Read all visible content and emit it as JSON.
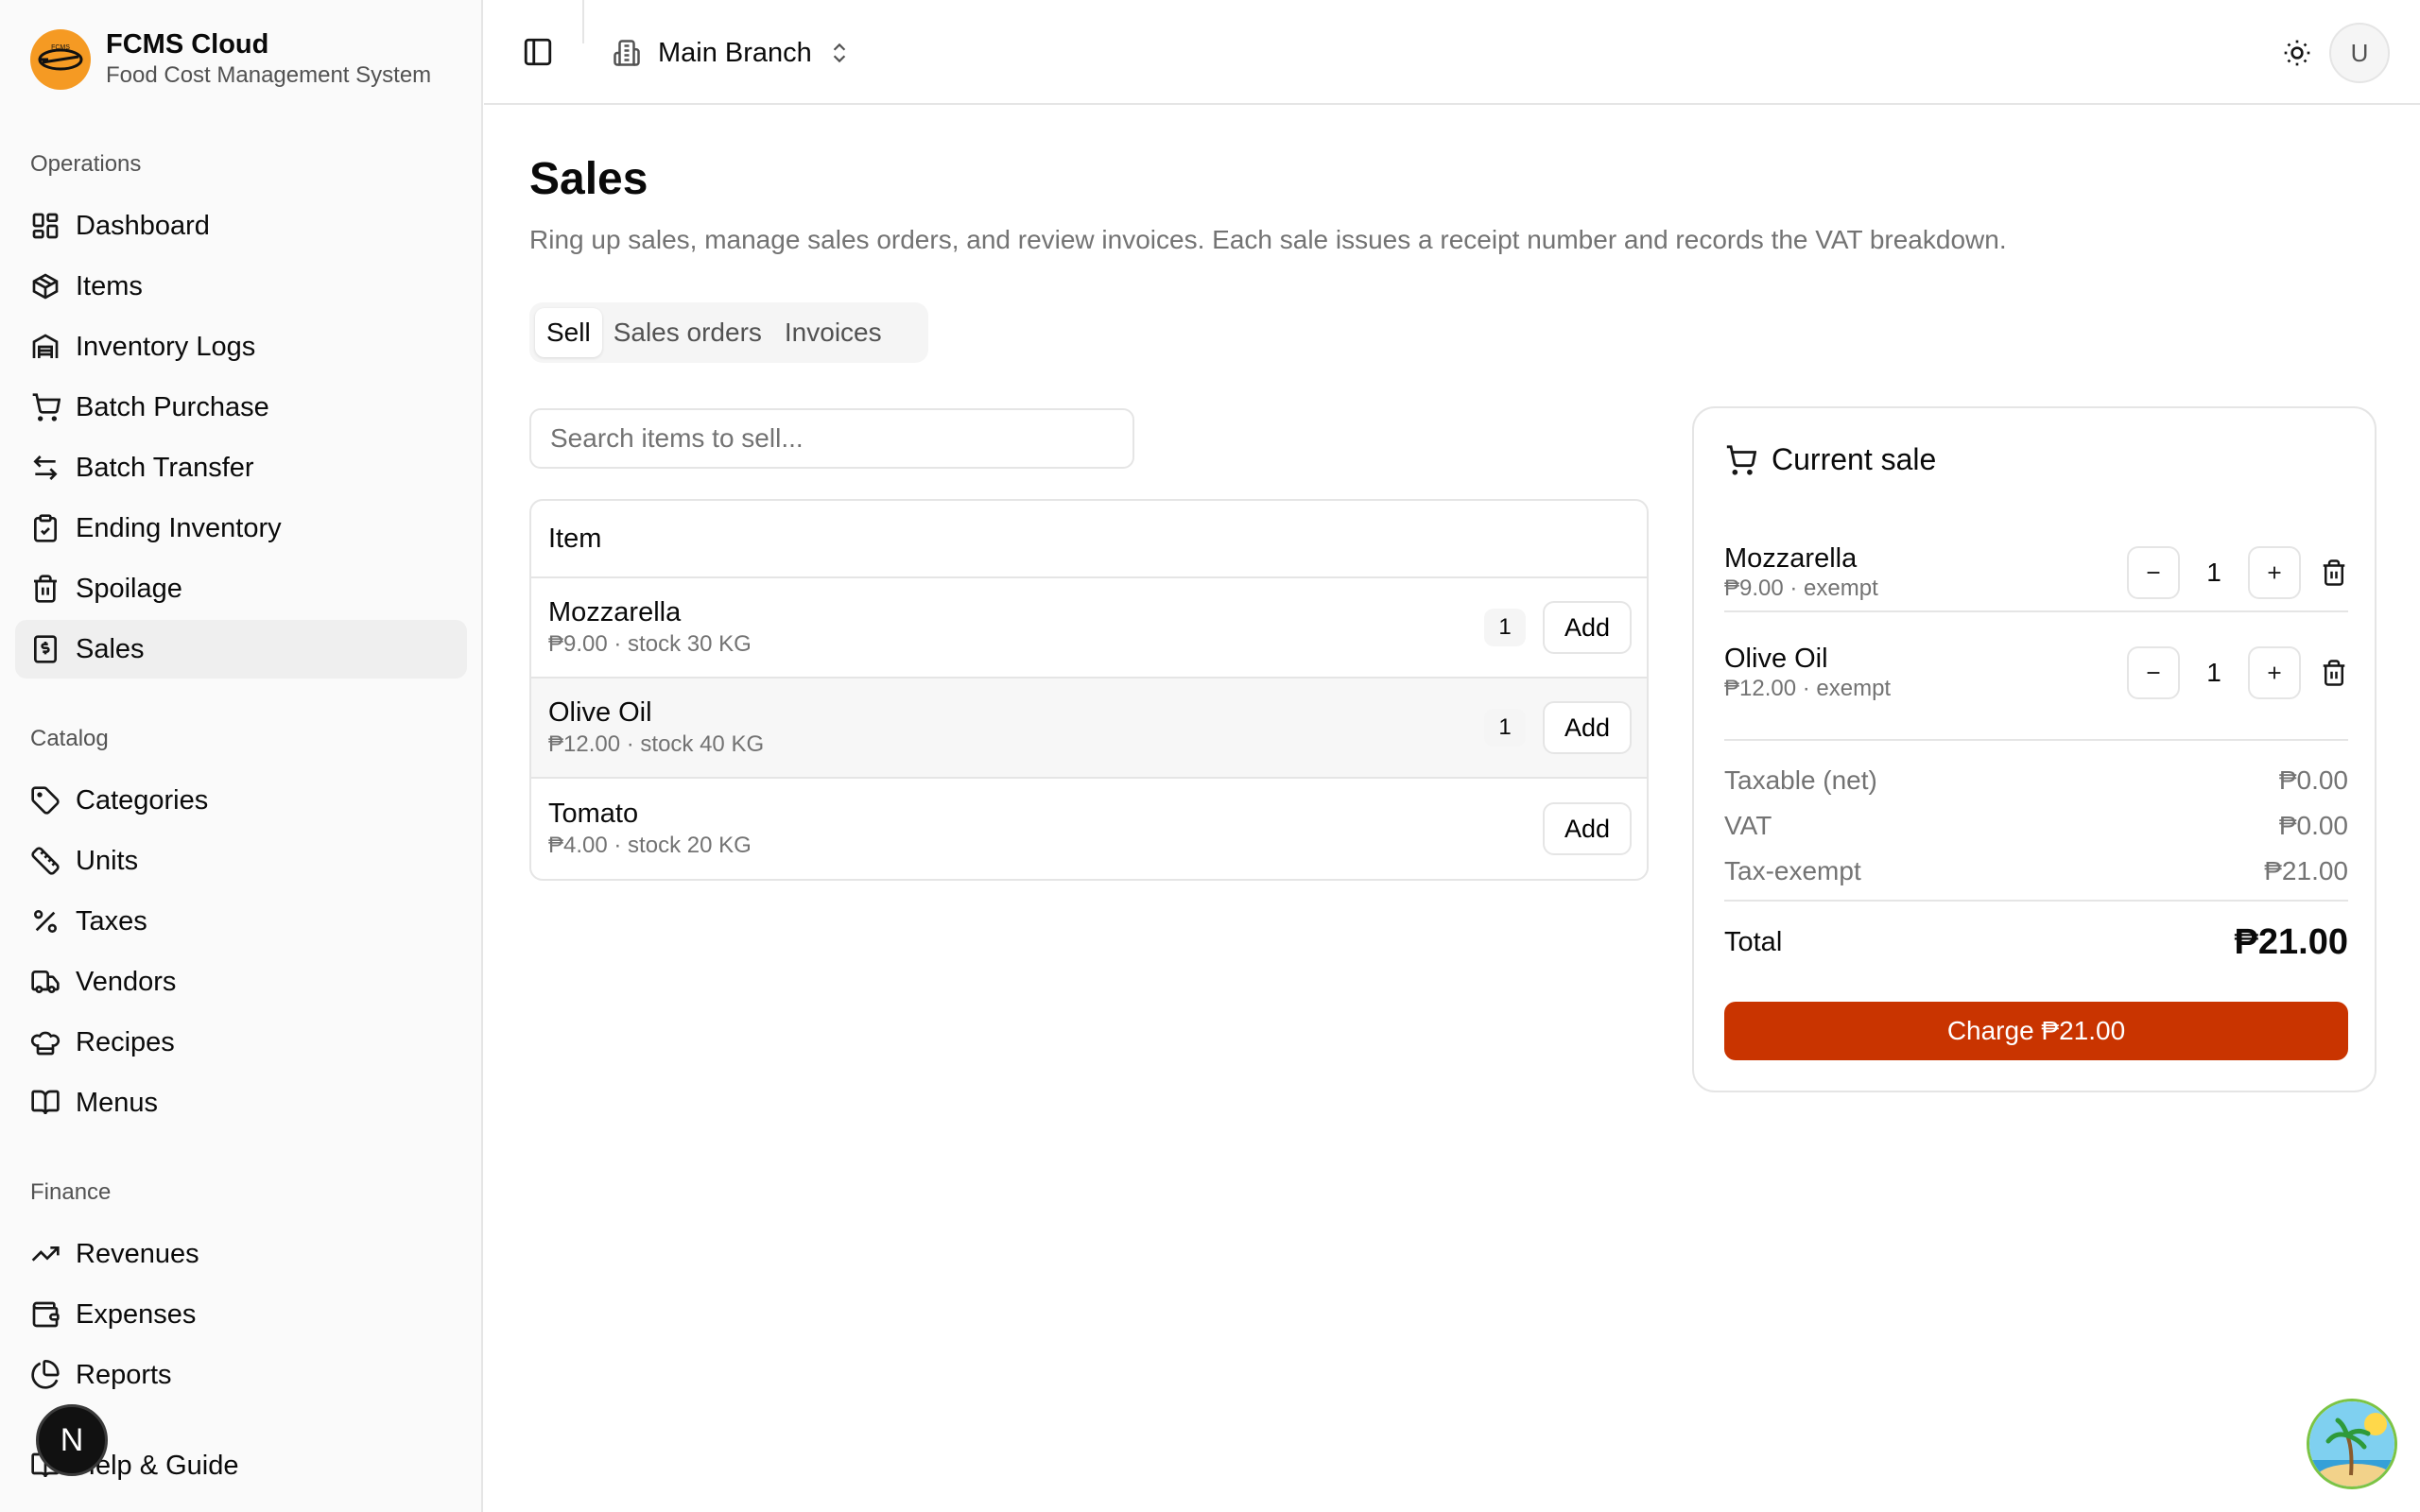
{
  "brand": {
    "title": "FCMS Cloud",
    "subtitle": "Food Cost Management System",
    "logo_text": "FCMS"
  },
  "sidebar": {
    "groups": [
      {
        "label": "Operations",
        "items": [
          {
            "label": "Dashboard",
            "icon": "dashboard-icon"
          },
          {
            "label": "Items",
            "icon": "package-icon"
          },
          {
            "label": "Inventory Logs",
            "icon": "warehouse-icon"
          },
          {
            "label": "Batch Purchase",
            "icon": "cart-icon"
          },
          {
            "label": "Batch Transfer",
            "icon": "transfer-icon"
          },
          {
            "label": "Ending Inventory",
            "icon": "clipboard-check-icon"
          },
          {
            "label": "Spoilage",
            "icon": "trash-icon"
          },
          {
            "label": "Sales",
            "icon": "receipt-icon",
            "active": true
          }
        ]
      },
      {
        "label": "Catalog",
        "items": [
          {
            "label": "Categories",
            "icon": "tag-icon"
          },
          {
            "label": "Units",
            "icon": "ruler-icon"
          },
          {
            "label": "Taxes",
            "icon": "percent-icon"
          },
          {
            "label": "Vendors",
            "icon": "truck-icon"
          },
          {
            "label": "Recipes",
            "icon": "chef-hat-icon"
          },
          {
            "label": "Menus",
            "icon": "book-open-icon"
          }
        ]
      },
      {
        "label": "Finance",
        "items": [
          {
            "label": "Revenues",
            "icon": "trending-up-icon"
          },
          {
            "label": "Expenses",
            "icon": "wallet-icon"
          },
          {
            "label": "Reports",
            "icon": "pie-chart-icon"
          },
          {
            "label": "Help & Guide",
            "icon": "book-icon"
          }
        ]
      }
    ],
    "dev_badge": "N"
  },
  "header": {
    "branch": "Main Branch",
    "avatar": "U"
  },
  "page": {
    "title": "Sales",
    "description": "Ring up sales, manage sales orders, and review invoices. Each sale issues a receipt number and records the VAT breakdown.",
    "tabs": [
      "Sell",
      "Sales orders",
      "Invoices"
    ],
    "active_tab": "Sell"
  },
  "search": {
    "placeholder": "Search items to sell...",
    "value": ""
  },
  "items_table": {
    "header": "Item",
    "add_label": "Add",
    "rows": [
      {
        "name": "Mozzarella",
        "meta": "₱9.00 · stock 30 KG",
        "in_cart": "1"
      },
      {
        "name": "Olive Oil",
        "meta": "₱12.00 · stock 40 KG",
        "in_cart": "1"
      },
      {
        "name": "Tomato",
        "meta": "₱4.00 · stock 20 KG",
        "in_cart": ""
      }
    ]
  },
  "cart": {
    "title": "Current sale",
    "lines": [
      {
        "name": "Mozzarella",
        "meta": "₱9.00 · exempt",
        "qty": "1"
      },
      {
        "name": "Olive Oil",
        "meta": "₱12.00 · exempt",
        "qty": "1"
      }
    ],
    "summary": {
      "taxable_label": "Taxable (net)",
      "taxable_value": "₱0.00",
      "vat_label": "VAT",
      "vat_value": "₱0.00",
      "exempt_label": "Tax-exempt",
      "exempt_value": "₱21.00"
    },
    "total_label": "Total",
    "total_value": "₱21.00",
    "charge_label": "Charge ₱21.00"
  },
  "colors": {
    "accent": "#c93400",
    "logo": "#f59a23",
    "sidebar_bg": "#fafafa",
    "border": "#e5e5e5"
  }
}
